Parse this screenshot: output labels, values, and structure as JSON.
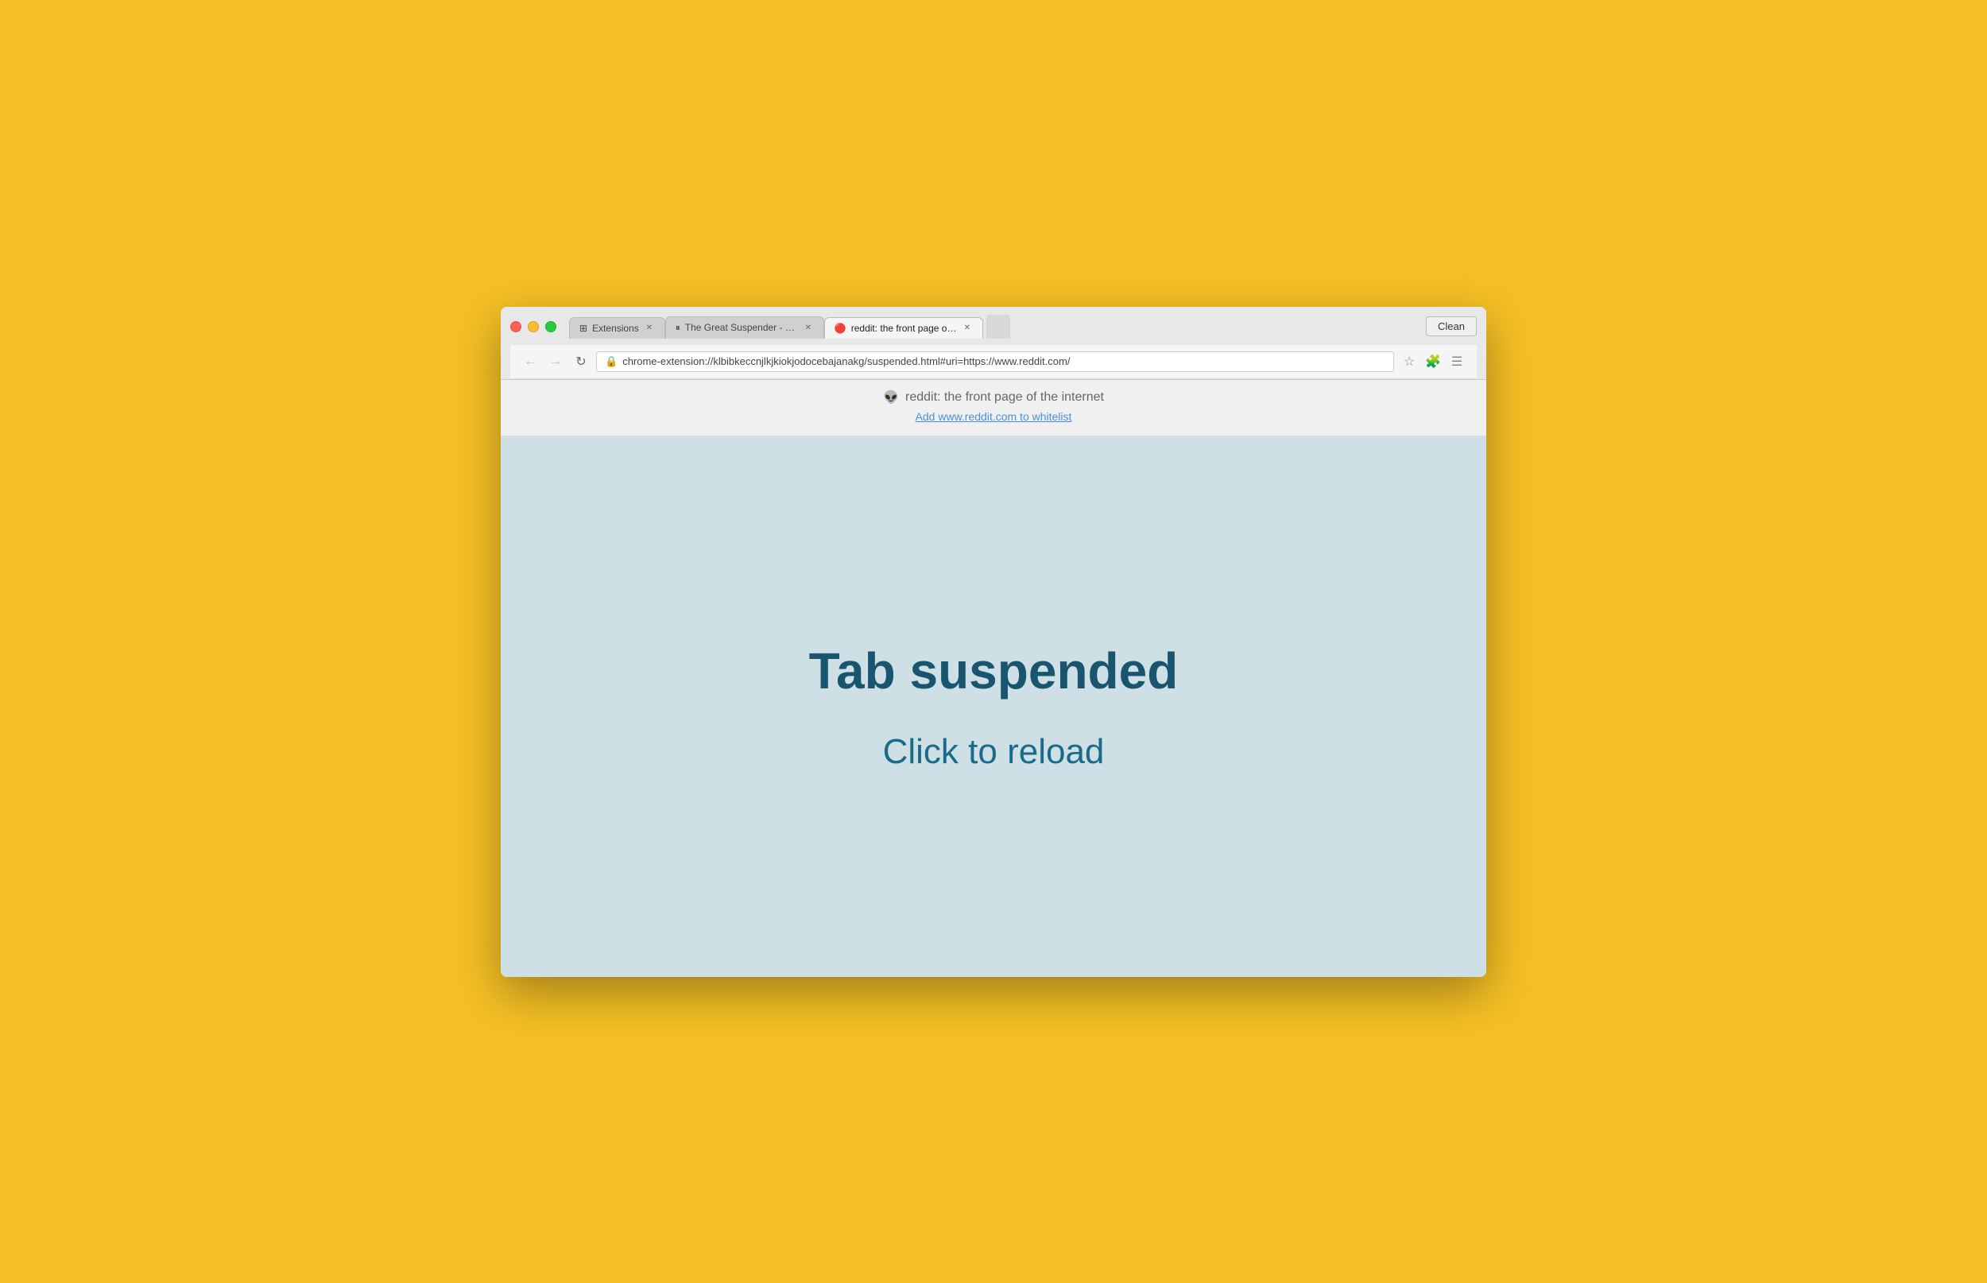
{
  "browser": {
    "clean_button_label": "Clean",
    "tabs": [
      {
        "id": "tab-extensions",
        "icon": "⊞",
        "title": "Extensions",
        "active": false,
        "closeable": true
      },
      {
        "id": "tab-great-suspender",
        "icon": "⏸",
        "title": "The Great Suspender - Ch…",
        "active": false,
        "closeable": true
      },
      {
        "id": "tab-reddit",
        "icon": "🔴",
        "title": "reddit: the front page of th…",
        "active": true,
        "closeable": true
      },
      {
        "id": "tab-ghost",
        "icon": "",
        "title": "",
        "active": false,
        "closeable": false
      }
    ],
    "url": "chrome-extension://klbibkeccnjlkjkiokjodocebajanakg/suspended.html#uri=https://www.reddit.com/",
    "url_icon": "🔒"
  },
  "info_bar": {
    "reddit_icon": "👽",
    "site_title": "reddit: the front page of the internet",
    "whitelist_link": "Add www.reddit.com to whitelist"
  },
  "main": {
    "heading": "Tab suspended",
    "subheading": "Click to reload"
  },
  "colors": {
    "background": "#F5C025",
    "main_content_bg": "#cfdfe6",
    "heading_color": "#1a5570",
    "subheading_color": "#1a6b8a"
  }
}
